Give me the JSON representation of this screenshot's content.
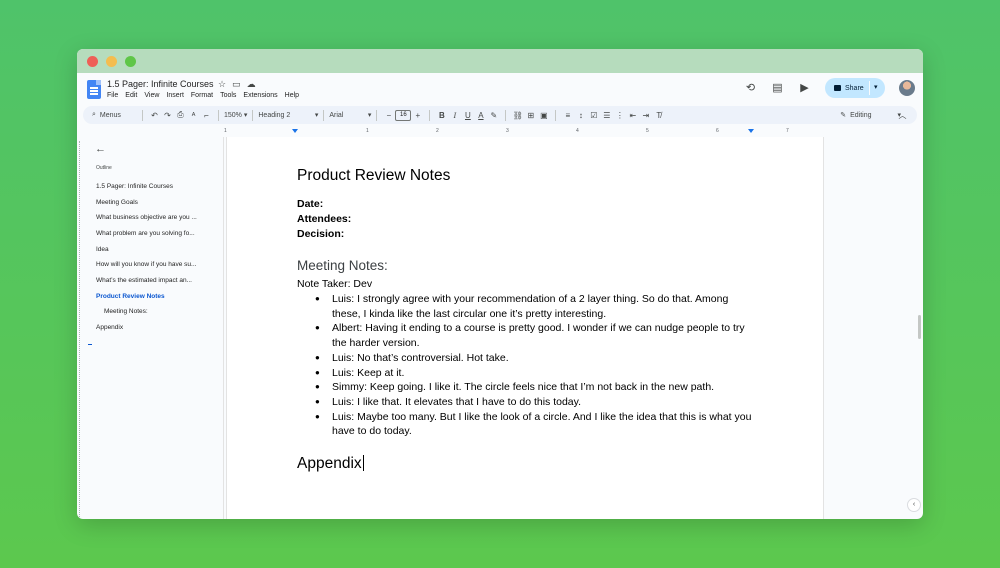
{
  "document": {
    "title": "1.5 Pager: Infinite Courses",
    "menus": [
      "File",
      "Edit",
      "View",
      "Insert",
      "Format",
      "Tools",
      "Extensions",
      "Help"
    ]
  },
  "header": {
    "share_label": "Share"
  },
  "toolbar": {
    "menus_search": "Menus",
    "zoom": "150%",
    "style": "Heading 2",
    "font": "Arial",
    "font_size": "16",
    "mode": "Editing"
  },
  "ruler": {
    "ticks": [
      "1",
      "1",
      "2",
      "3",
      "4",
      "5",
      "6",
      "7"
    ]
  },
  "outline": {
    "label": "Outline",
    "items": [
      {
        "label": "1.5 Pager: Infinite Courses"
      },
      {
        "label": "Meeting Goals"
      },
      {
        "label": "What business objective are you ..."
      },
      {
        "label": "What problem are you solving fo..."
      },
      {
        "label": "Idea"
      },
      {
        "label": "How will you know if you have su..."
      },
      {
        "label": "What’s the estimated impact an..."
      },
      {
        "label": "Product Review Notes"
      },
      {
        "label": "Meeting Notes:"
      },
      {
        "label": "Appendix"
      }
    ]
  },
  "content": {
    "title": "Product Review Notes",
    "date_label": "Date:",
    "attendees_label": "Attendees:",
    "decision_label": "Decision:",
    "notes_heading": "Meeting Notes:",
    "note_taker": "Note Taker: Dev",
    "bullets": [
      "Luis: I strongly agree with your recommendation of a 2 layer thing. So do that. Among these, I  kinda like the last circular one  it’s pretty interesting.",
      "Albert: Having it ending to a course is pretty good. I wonder if we can nudge people to try the harder version.",
      "Luis: No that’s controversial. Hot take.",
      "Luis: Keep at it.",
      "Simmy: Keep going. I like it. The circle feels nice that I’m not back in the new path.",
      "Luis: I like that. It elevates that I have to do this today.",
      "Luis: Maybe too many. But I like the look of a circle. And I like the idea that this is what you have to do today."
    ],
    "appendix_heading": "Appendix"
  }
}
